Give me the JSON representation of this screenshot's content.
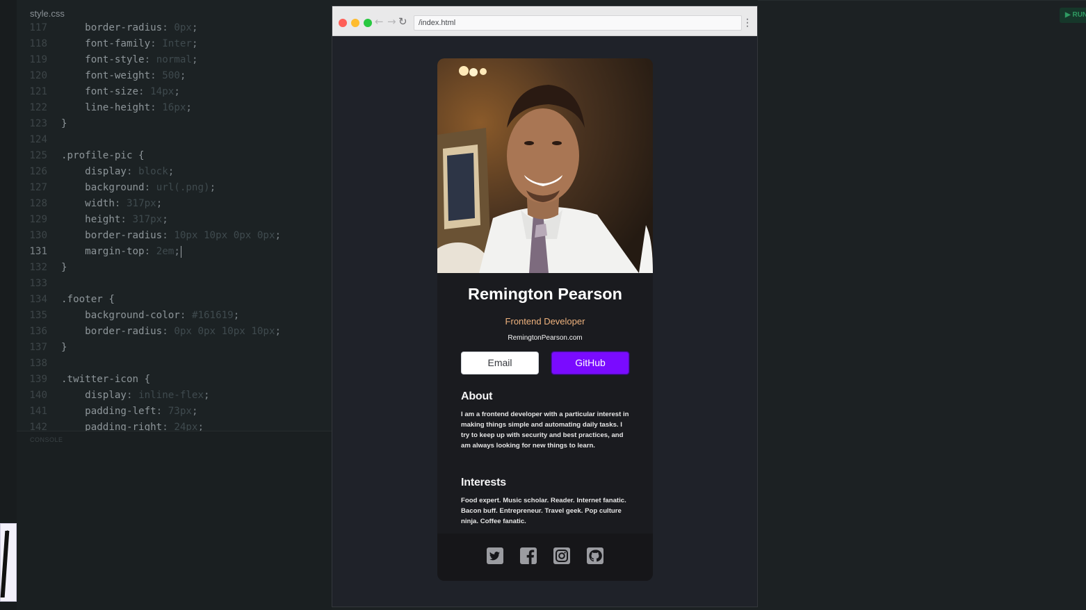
{
  "editor": {
    "tab_label": "style.css",
    "console_label": "CONSOLE",
    "lines": [
      {
        "n": "117",
        "indent": true,
        "prop": "border-radius",
        "value": "0px",
        "end": ";"
      },
      {
        "n": "118",
        "indent": true,
        "prop": "font-family",
        "value": "Inter",
        "end": ";"
      },
      {
        "n": "119",
        "indent": true,
        "prop": "font-style",
        "value": "normal",
        "end": ";"
      },
      {
        "n": "120",
        "indent": true,
        "prop": "font-weight",
        "value": "500",
        "end": ";"
      },
      {
        "n": "121",
        "indent": true,
        "prop": "font-size",
        "value": "14px",
        "end": ";"
      },
      {
        "n": "122",
        "indent": true,
        "prop": "line-height",
        "value": "16px",
        "end": ";"
      },
      {
        "n": "123",
        "text": "}"
      },
      {
        "n": "124",
        "text": ""
      },
      {
        "n": "125",
        "text": ".profile-pic {"
      },
      {
        "n": "126",
        "indent": true,
        "prop": "display",
        "value": "block",
        "end": ";"
      },
      {
        "n": "127",
        "indent": true,
        "prop": "background",
        "value": "url(.png)",
        "end": ";"
      },
      {
        "n": "128",
        "indent": true,
        "prop": "width",
        "value": "317px",
        "end": ";"
      },
      {
        "n": "129",
        "indent": true,
        "prop": "height",
        "value": "317px",
        "end": ";"
      },
      {
        "n": "130",
        "indent": true,
        "prop": "border-radius",
        "value": "10px 10px 0px 0px",
        "end": ";"
      },
      {
        "n": "131",
        "indent": true,
        "prop": "margin-top",
        "value": "2em",
        "end": ";",
        "current": true
      },
      {
        "n": "132",
        "text": "}"
      },
      {
        "n": "133",
        "text": ""
      },
      {
        "n": "134",
        "text": ".footer {"
      },
      {
        "n": "135",
        "indent": true,
        "prop": "background-color",
        "value": "#161619",
        "end": ";"
      },
      {
        "n": "136",
        "indent": true,
        "prop": "border-radius",
        "value": "0px 0px 10px 10px",
        "end": ";"
      },
      {
        "n": "137",
        "text": "}"
      },
      {
        "n": "138",
        "text": ""
      },
      {
        "n": "139",
        "text": ".twitter-icon {"
      },
      {
        "n": "140",
        "indent": true,
        "prop": "display",
        "value": "inline-flex",
        "end": ";"
      },
      {
        "n": "141",
        "indent": true,
        "prop": "padding-left",
        "value": "73px",
        "end": ";"
      },
      {
        "n": "142",
        "indent": true,
        "prop": "padding-right",
        "value": "24px",
        "end": ";"
      }
    ]
  },
  "run_button": {
    "label": "▶ RUN"
  },
  "browser": {
    "url": "/index.html",
    "menu_icon": "kebab-menu-icon"
  },
  "card": {
    "name": "Remington Pearson",
    "role": "Frontend Developer",
    "website": "RemingtonPearson.com",
    "email_label": "Email",
    "github_label": "GitHub",
    "about_heading": "About",
    "about_text": "I am a frontend developer with a particular interest in making things simple and automating daily tasks. I try to keep up with security and best practices, and am always looking for new things to learn.",
    "interests_heading": "Interests",
    "interests_text": "Food expert. Music scholar. Reader. Internet fanatic. Bacon buff. Entrepreneur. Travel geek. Pop culture ninja. Coffee fanatic.",
    "social_icons": [
      "twitter-icon",
      "facebook-icon",
      "instagram-icon",
      "github-icon"
    ]
  },
  "colors": {
    "accent": "#7a0bff",
    "role_text": "#f0b37e",
    "footer_bg": "#161619",
    "card_bg": "#1a1b1f"
  }
}
